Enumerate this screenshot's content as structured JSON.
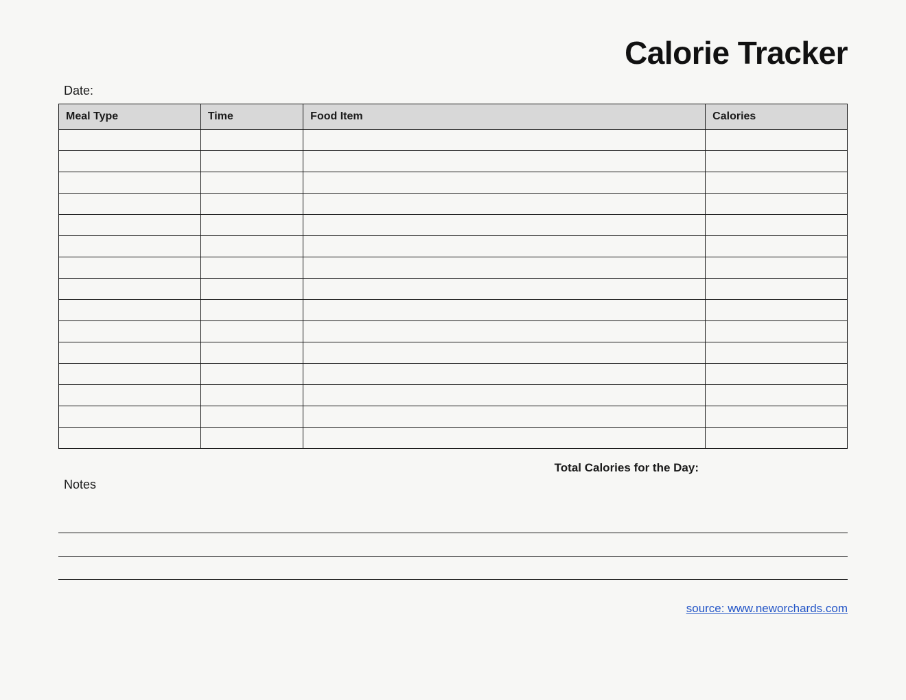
{
  "title": "Calorie Tracker",
  "date_label": "Date:",
  "columns": {
    "meal_type": "Meal Type",
    "time": "Time",
    "food_item": "Food Item",
    "calories": "Calories"
  },
  "rows": [
    {
      "meal_type": "",
      "time": "",
      "food_item": "",
      "calories": ""
    },
    {
      "meal_type": "",
      "time": "",
      "food_item": "",
      "calories": ""
    },
    {
      "meal_type": "",
      "time": "",
      "food_item": "",
      "calories": ""
    },
    {
      "meal_type": "",
      "time": "",
      "food_item": "",
      "calories": ""
    },
    {
      "meal_type": "",
      "time": "",
      "food_item": "",
      "calories": ""
    },
    {
      "meal_type": "",
      "time": "",
      "food_item": "",
      "calories": ""
    },
    {
      "meal_type": "",
      "time": "",
      "food_item": "",
      "calories": ""
    },
    {
      "meal_type": "",
      "time": "",
      "food_item": "",
      "calories": ""
    },
    {
      "meal_type": "",
      "time": "",
      "food_item": "",
      "calories": ""
    },
    {
      "meal_type": "",
      "time": "",
      "food_item": "",
      "calories": ""
    },
    {
      "meal_type": "",
      "time": "",
      "food_item": "",
      "calories": ""
    },
    {
      "meal_type": "",
      "time": "",
      "food_item": "",
      "calories": ""
    },
    {
      "meal_type": "",
      "time": "",
      "food_item": "",
      "calories": ""
    },
    {
      "meal_type": "",
      "time": "",
      "food_item": "",
      "calories": ""
    },
    {
      "meal_type": "",
      "time": "",
      "food_item": "",
      "calories": ""
    }
  ],
  "total_label": "Total Calories for the Day:",
  "total_value": "",
  "notes_label": "Notes",
  "note_lines": 3,
  "source_text": "source: www.neworchards.com"
}
